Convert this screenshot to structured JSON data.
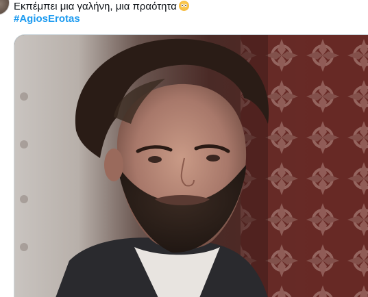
{
  "tweet": {
    "text": "Εκπέμπει μια γαλήνη, μια πραότητα",
    "emoji": "pleading-face-emoji",
    "hashtag": "#AgiosErotas"
  },
  "media": {
    "type": "video-still",
    "subject": "bearded man in dark clerical shirt"
  },
  "colors": {
    "hashtag": "#1d9bf0",
    "text": "#0f1419",
    "border": "#cfd9de"
  }
}
